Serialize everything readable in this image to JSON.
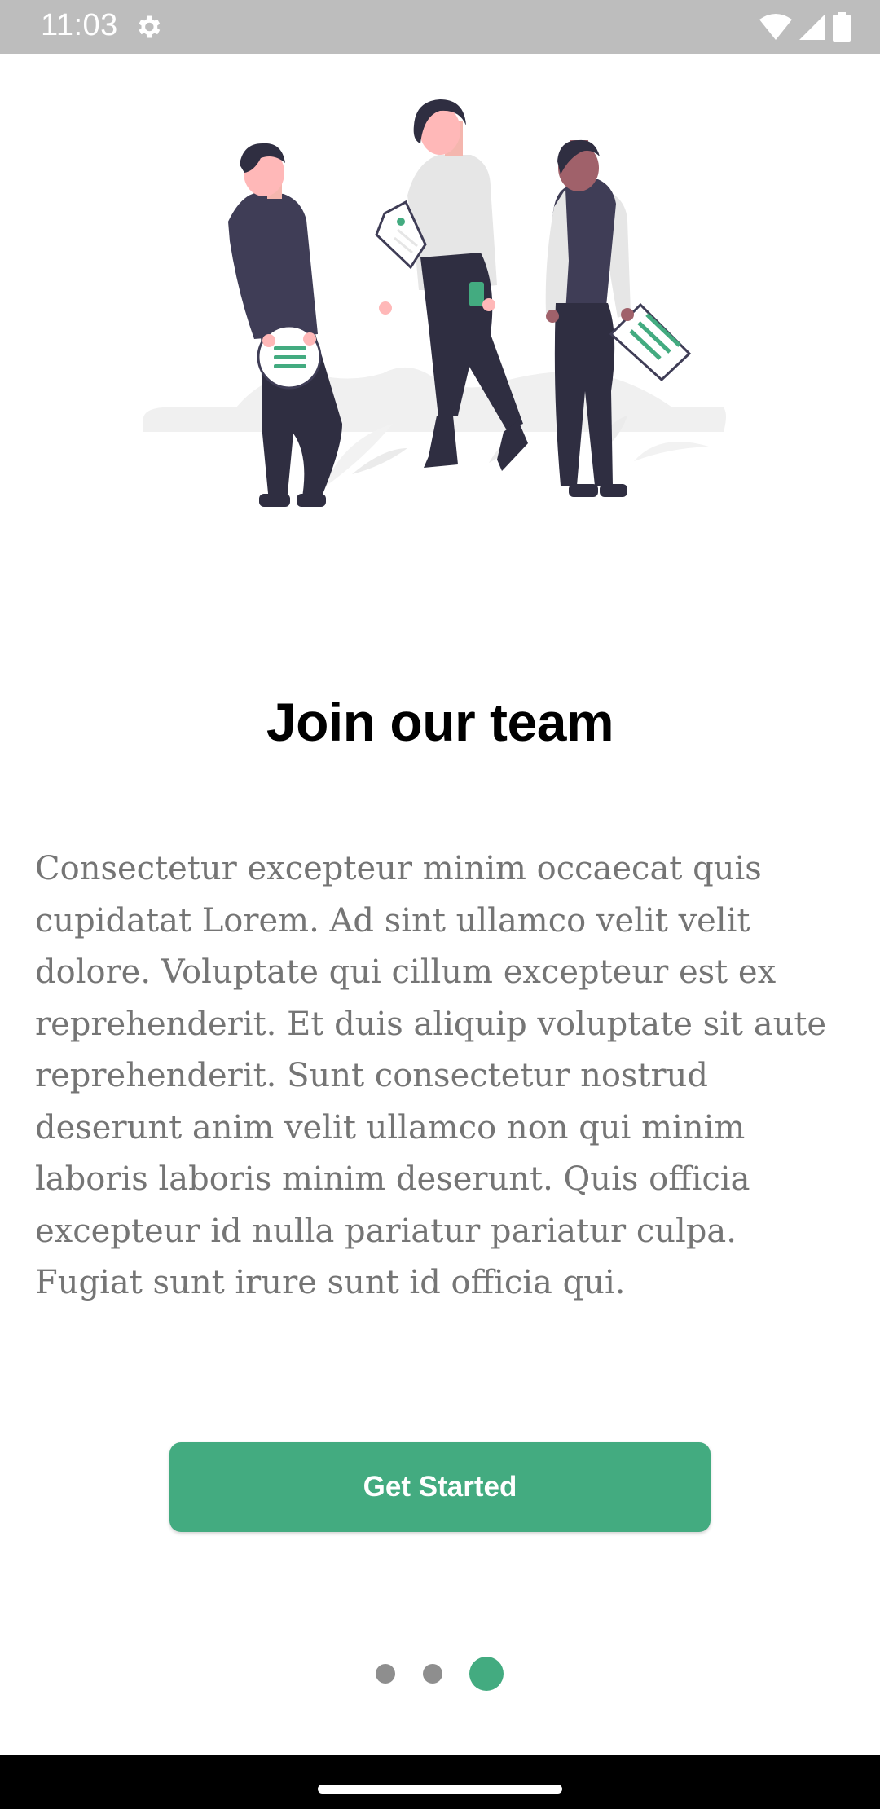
{
  "status_bar": {
    "time": "11:03",
    "icons": [
      "gear-icon",
      "wifi-icon",
      "cell-signal-icon",
      "battery-icon"
    ]
  },
  "illustration": {
    "icon": "team-people-illustration"
  },
  "onboarding": {
    "title": "Join our team",
    "body": "Consectetur excepteur minim occaecat quis cupidatat Lorem. Ad sint ullamco velit velit dolore. Voluptate qui cillum excepteur est ex reprehenderit. Et duis aliquip voluptate sit aute reprehenderit. Sunt consectetur nostrud deserunt anim velit ullamco non qui minim laboris laboris minim deserunt. Quis officia excepteur id nulla pariatur pariatur culpa. Fugiat sunt irure sunt id officia qui.",
    "cta_label": "Get Started"
  },
  "pager": {
    "total_pages": 3,
    "current_page": 3
  },
  "colors": {
    "accent": "#43ab80",
    "status_bar": "#bdbdbd",
    "body_text": "#757575",
    "inactive_dot": "#8e8e8e"
  }
}
